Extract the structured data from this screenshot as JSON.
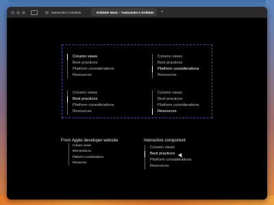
{
  "browser": {
    "tabs": [
      {
        "label": "Yashwinder's Dribbble"
      },
      {
        "label": "Dribbble Work – Yashwinder's Dribbble"
      }
    ],
    "new_tab_symbol": "+"
  },
  "demo": {
    "groups": [
      {
        "items": [
          {
            "label": "Column views",
            "active": true
          },
          {
            "label": "Best practices",
            "active": false
          },
          {
            "label": "Platform considerations",
            "active": false
          },
          {
            "label": "Resources",
            "active": false
          }
        ]
      },
      {
        "items": [
          {
            "label": "Column views",
            "active": false
          },
          {
            "label": "Best practices",
            "active": false
          },
          {
            "label": "Platform considerations",
            "active": true
          },
          {
            "label": "Resources",
            "active": false
          }
        ]
      },
      {
        "items": [
          {
            "label": "Column views",
            "active": false
          },
          {
            "label": "Best practices",
            "active": true
          },
          {
            "label": "Platform considerations",
            "active": false
          },
          {
            "label": "Resources",
            "active": false
          }
        ]
      },
      {
        "items": [
          {
            "label": "Column views",
            "active": false
          },
          {
            "label": "Best practices",
            "active": false
          },
          {
            "label": "Platform considerations",
            "active": false
          },
          {
            "label": "Resources",
            "active": true
          }
        ]
      }
    ]
  },
  "apple_section": {
    "heading": "From Apple developer website",
    "items": [
      "Column views",
      "Best practices",
      "Platform considerations",
      "Resources"
    ]
  },
  "interactive_section": {
    "heading": "Interactive component",
    "items": [
      {
        "label": "Column views",
        "active": false
      },
      {
        "label": "Best practices",
        "active": true
      },
      {
        "label": "Platform considerations",
        "active": false
      },
      {
        "label": "Resources",
        "active": false
      }
    ]
  },
  "colors": {
    "dashed_border": "#4b4c9a",
    "active_text": "#ffffff",
    "inactive_text": "#bdbdbd"
  }
}
